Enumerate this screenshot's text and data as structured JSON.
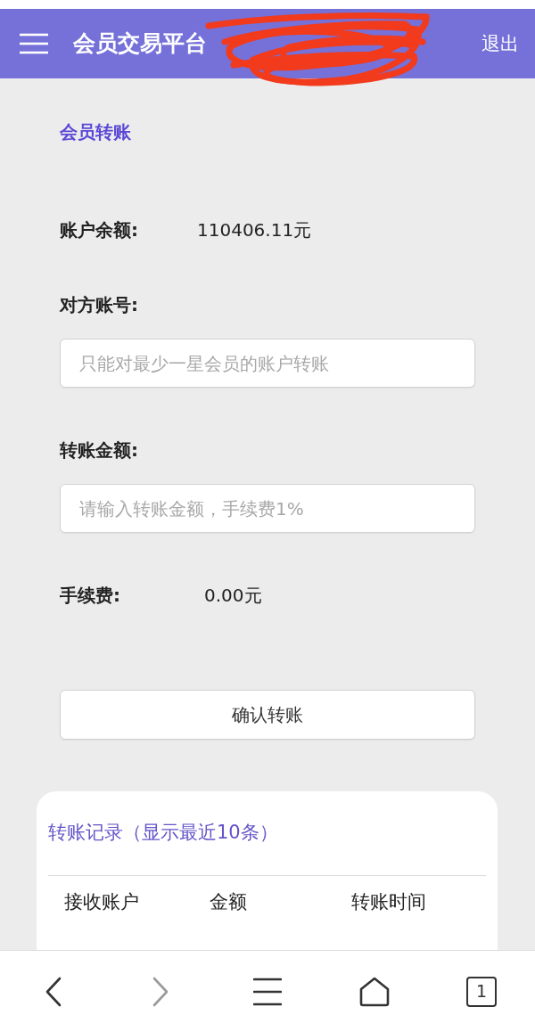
{
  "header": {
    "title": "会员交易平台",
    "logout": "退出"
  },
  "transfer": {
    "title": "会员转账",
    "balance": {
      "label": "账户余额:",
      "value": "110406.11元"
    },
    "fields": [
      {
        "label": "对方账号:",
        "placeholder": "只能对最少一星会员的账户转账"
      },
      {
        "label": "转账金额:",
        "placeholder": "请输入转账金额，手续费1%"
      }
    ],
    "fee": {
      "label": "手续费:",
      "value": "0.00元"
    },
    "submit": "确认转账"
  },
  "records": {
    "title": "转账记录（显示最近10条）",
    "columns": [
      "接收账户",
      "金额",
      "转账时间"
    ]
  },
  "browser_bar": {
    "items": [
      {
        "kind": "back",
        "disabled": false
      },
      {
        "kind": "forward",
        "disabled": true
      },
      {
        "kind": "menu",
        "disabled": false
      },
      {
        "kind": "home",
        "disabled": false
      },
      {
        "kind": "tabs",
        "count": "1",
        "disabled": false
      }
    ]
  }
}
